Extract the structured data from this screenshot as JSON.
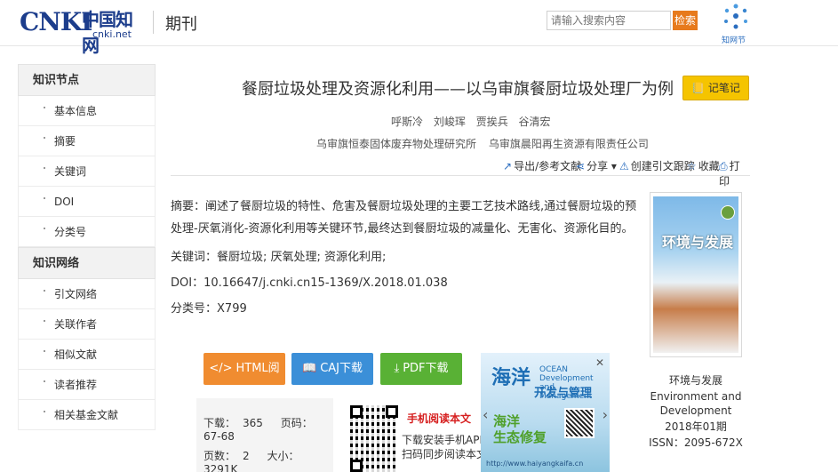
{
  "header": {
    "logo_text": "CNKI",
    "logo_zh": "中国知网",
    "logo_url": "cnki.net",
    "section_title": "期刊",
    "search_placeholder": "请输入搜索内容",
    "search_button": "检索",
    "festival_text": "知网节"
  },
  "sidebar": {
    "groups": [
      {
        "title": "知识节点",
        "items": [
          "基本信息",
          "摘要",
          "关键词",
          "DOI",
          "分类号"
        ]
      },
      {
        "title": "知识网络",
        "items": [
          "引文网络",
          "关联作者",
          "相似文献",
          "读者推荐",
          "相关基金文献"
        ]
      }
    ]
  },
  "article": {
    "title": "餐厨垃圾处理及资源化利用——以乌审旗餐厨垃圾处理厂为例",
    "note_button": "记笔记",
    "authors": [
      "呼斯冷",
      "刘峻珲",
      "贾挨兵",
      "谷清宏"
    ],
    "orgs": [
      "乌审旗恒泰固体废弃物处理研究所",
      "乌审旗晨阳再生资源有限责任公司"
    ],
    "actions": {
      "export": "导出/参考文献",
      "share": "分享",
      "track": "创建引文跟踪",
      "favorite": "收藏",
      "print": "打印"
    },
    "abstract_label": "摘要：",
    "abstract": "阐述了餐厨垃圾的特性、危害及餐厨垃圾处理的主要工艺技术路线,通过餐厨垃圾的预处理-厌氧消化-资源化利用等关键环节,最终达到餐厨垃圾的减量化、无害化、资源化目的。",
    "keywords_label": "关键词：",
    "keywords": "餐厨垃圾; 厌氧处理; 资源化利用;",
    "doi_label": "DOI：",
    "doi": "10.16647/j.cnki.cn15-1369/X.2018.01.038",
    "class_label": "分类号：",
    "class_no": "X799"
  },
  "buttons": {
    "html": "HTML阅读",
    "caj": "CAJ下载",
    "pdf": "PDF下载"
  },
  "stats": {
    "downloads_label": "下载：",
    "downloads": "365",
    "pages_label": "页码：",
    "pages": "67-68",
    "page_count_label": "页数：",
    "page_count": "2",
    "size_label": "大小：",
    "size": "3291K"
  },
  "mobile": {
    "title": "手机阅读本文",
    "line1": "下载安装手机APP",
    "line2": "扫码同步阅读本文"
  },
  "ad": {
    "title": "海洋",
    "en_line1": "OCEAN",
    "en_line2": "Development and Management",
    "subtitle": "开发与管理",
    "green_line1": "海洋",
    "green_line2": "生态修复",
    "url": "http://www.haiyangkaifa.cn"
  },
  "journal": {
    "cover_title": "环境与发展",
    "name_zh": "环境与发展",
    "name_en": "Environment and Development",
    "issue": "2018年01期",
    "issn": "ISSN：2095-672X"
  },
  "colors": {
    "brand_blue": "#1c3d8c",
    "search_orange": "#e77a1c",
    "note_yellow": "#f5c400",
    "html_orange": "#f08c30",
    "caj_blue": "#3b8fd8",
    "pdf_green": "#59b135",
    "mobile_red": "#d61f1f"
  }
}
